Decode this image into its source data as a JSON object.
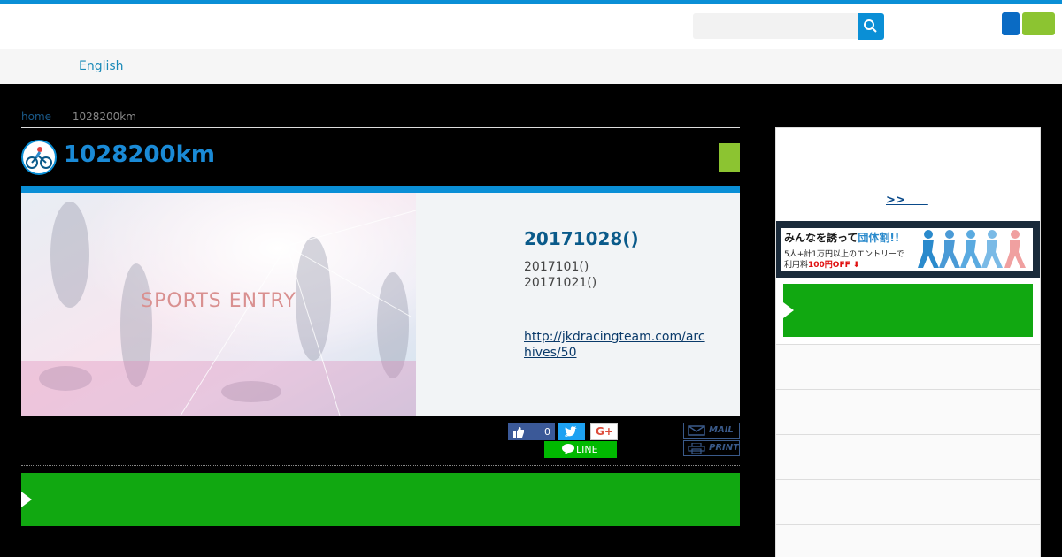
{
  "header": {
    "search": {
      "placeholder": ""
    },
    "colors": {
      "accent": "#0a8fd6",
      "button_blue": "#0a6bc4",
      "button_green": "#8cc431"
    }
  },
  "nav": {
    "english_label": "English"
  },
  "breadcrumb": {
    "home": "home",
    "current": "1028200km"
  },
  "page": {
    "title": "1028200km"
  },
  "article": {
    "hero_text": "SPORTS ENTRY",
    "event_date": "20171028()",
    "info_line1": "2017101()",
    "info_line2": "20171021()",
    "link": "http://jkdracingteam.com/archives/50"
  },
  "share": {
    "like_count": "0",
    "google_label": "G+",
    "line_label": "LINE",
    "mail_label": "MAIL",
    "print_label": "PRINT"
  },
  "sidebar": {
    "more_link": ">>　　",
    "banner": {
      "line1_main": "みんなを誘って",
      "line1_accent": "団体割!!",
      "line2": "5人+計1万円以上のエントリーで",
      "line3_prefix": "利用料",
      "line3_red": "100円OFF ⬇"
    }
  },
  "colors": {
    "cta_green": "#11a811",
    "title_blue": "#1a8ad6"
  }
}
